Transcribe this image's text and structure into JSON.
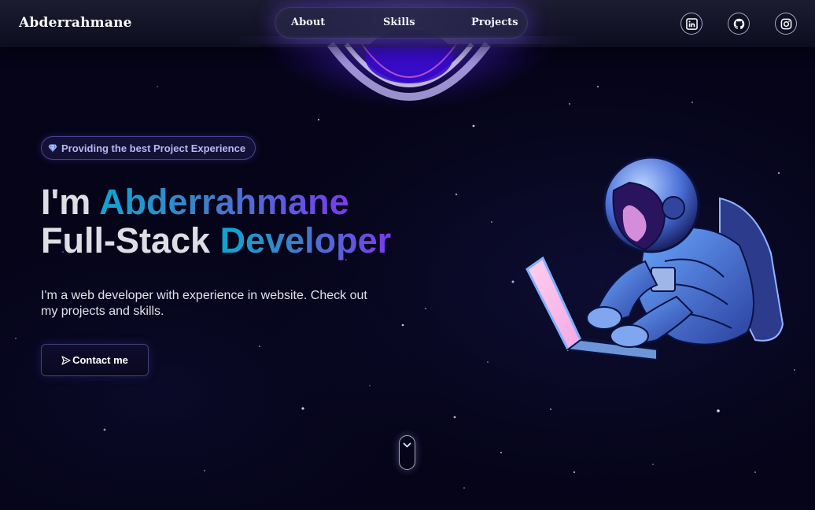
{
  "navbar": {
    "brand": "Abderrahmane",
    "links": [
      {
        "label": "About"
      },
      {
        "label": "Skills"
      },
      {
        "label": "Projects"
      }
    ],
    "social": [
      {
        "icon": "linkedin-icon"
      },
      {
        "icon": "github-icon"
      },
      {
        "icon": "instagram-icon"
      }
    ]
  },
  "hero": {
    "badge": {
      "icon": "gem-icon",
      "text": "Providing the best Project Experience"
    },
    "headline": {
      "line1_prefix": "I'm ",
      "line1_highlight": "Abderrahmane",
      "line2_prefix": "Full-Stack ",
      "line2_highlight": "Developer"
    },
    "description": "I'm a web developer with experience in website. Check out my projects and skills.",
    "contact_button": {
      "icon": "send-icon",
      "label": "Contact me"
    }
  },
  "scroll_indicator": {
    "icon": "chevron-down-icon"
  },
  "colors": {
    "background": "#050418",
    "gradient_start": "#0ea5d4",
    "gradient_end": "#7c3aed",
    "portal_glow": "#6d4aff"
  }
}
